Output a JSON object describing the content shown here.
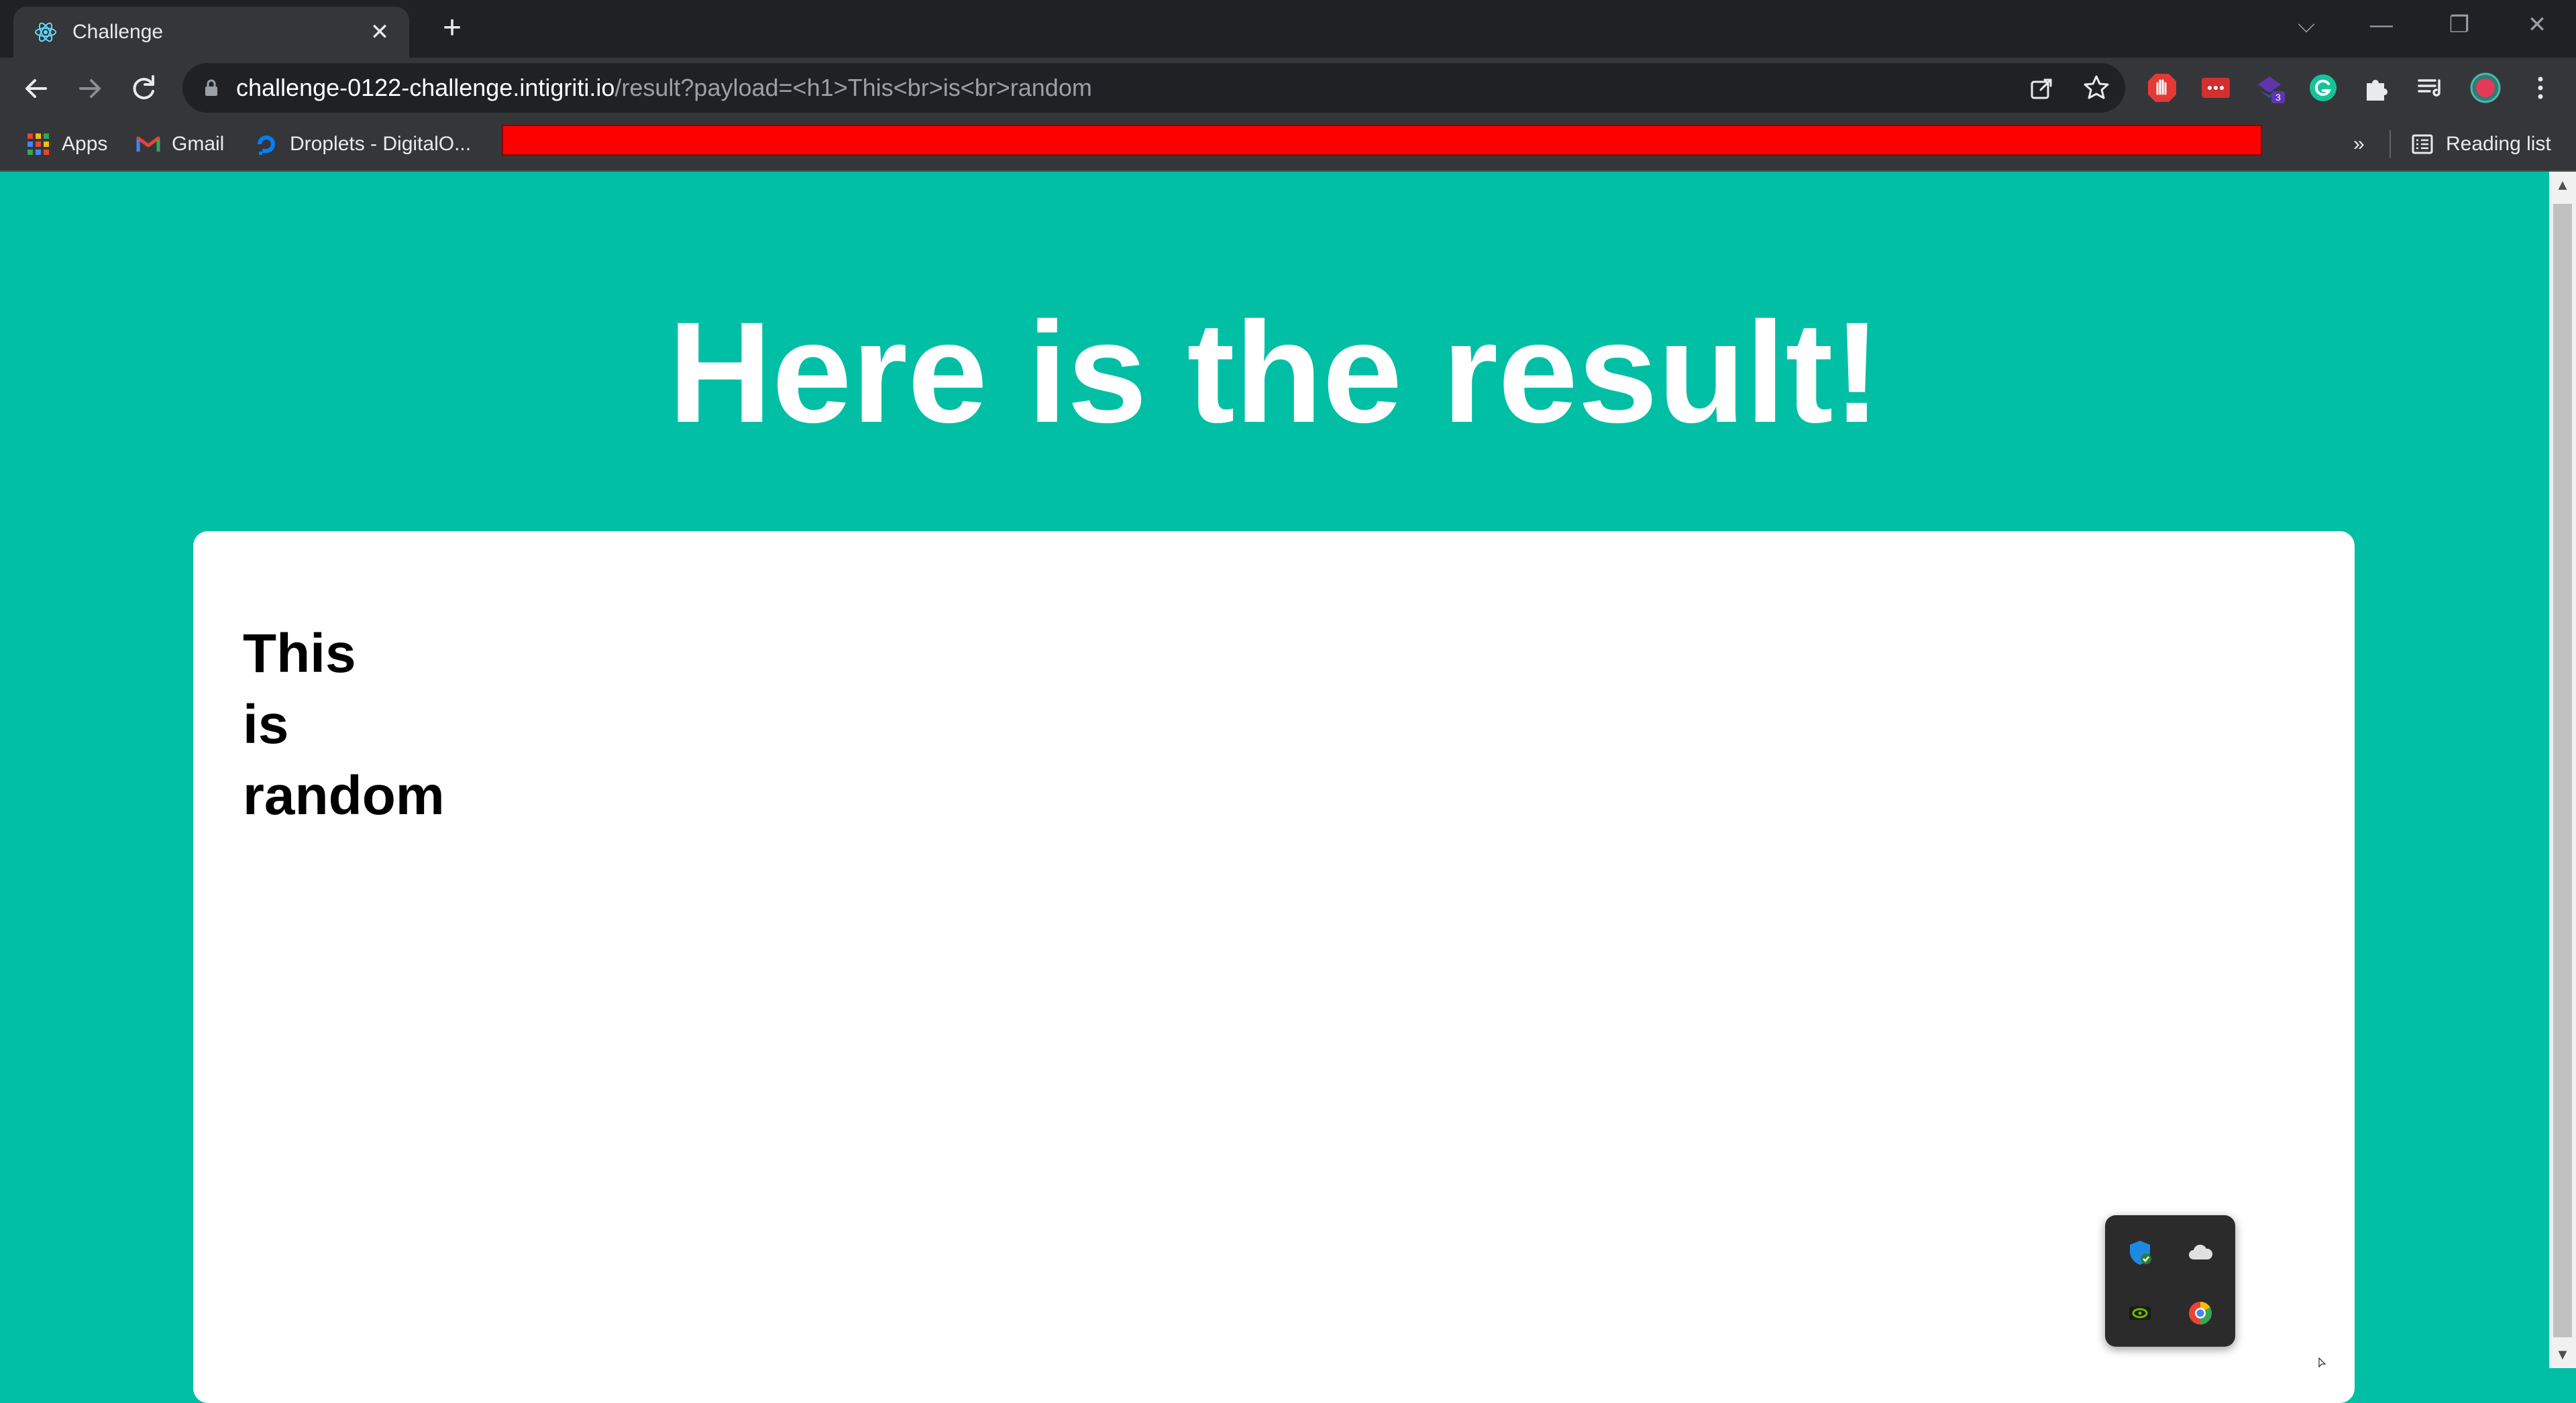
{
  "browser": {
    "tab_title": "Challenge",
    "tab_close": "✕",
    "new_tab": "+",
    "url_host": "challenge-0122-challenge.intigriti.io",
    "url_path": "/result?payload=<h1>This<br>is<br>random",
    "window_controls": {
      "dropdown": "⌵",
      "minimize": "—",
      "restore": "❐",
      "close": "✕"
    }
  },
  "bookmarks": {
    "apps": "Apps",
    "gmail": "Gmail",
    "droplets": "Droplets - DigitalO...",
    "overflow": "»",
    "reading_list": "Reading list"
  },
  "extensions": {
    "badge_count": "3"
  },
  "page": {
    "heading": "Here is the result!",
    "result_lines": [
      "This",
      "is",
      "random"
    ]
  },
  "colors": {
    "page_bg": "#00bfa5",
    "card_bg": "#ffffff",
    "highlight_bar": "#ff0000"
  }
}
